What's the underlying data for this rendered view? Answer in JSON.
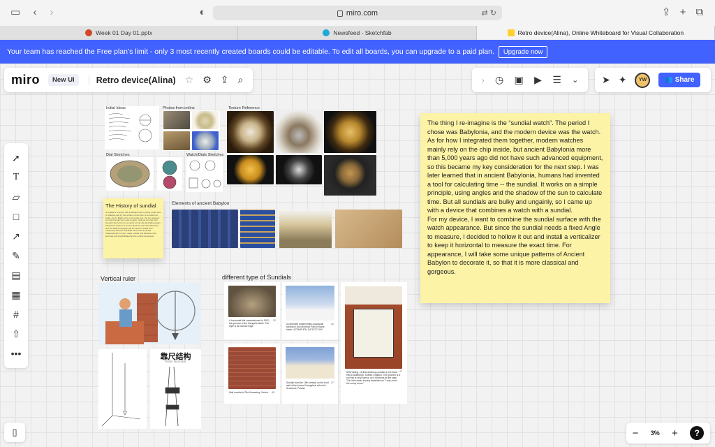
{
  "browser": {
    "url": "miro.com",
    "tabs": [
      {
        "label": "Week 01 Day 01.pptx",
        "icon": "powerpoint-icon",
        "active": false
      },
      {
        "label": "Newsfeed - Sketchfab",
        "icon": "sketchfab-icon",
        "active": false
      },
      {
        "label": "Retro device(Alina), Online Whiteboard for Visual Collaboration",
        "icon": "miro-icon",
        "active": true
      }
    ]
  },
  "banner": {
    "text": "Your team has reached the Free plan’s limit - only 3 most recently created boards could be editable. To edit all boards, you can upgrade to a paid plan.",
    "button": "Upgrade now"
  },
  "app": {
    "logo": "miro",
    "badge": "New UI",
    "board_title": "Retro device(Alina)",
    "share": "Share",
    "avatar": "YW",
    "zoom": "3%",
    "help": "?"
  },
  "board": {
    "initial_ideas": "Initial Ideas",
    "photos_online": "Photos from online",
    "texture_ref": "Texture Reference",
    "dial_sketches": "Dial Sketches",
    "watch_sketches": "Watch/Dials Sketches",
    "history_title": "The History of sundial",
    "history_body": "A sundial is a device that indicates time by using a light spot or shadow cast by the position of the Sun on a reference scale. As the Earth turns on its polar axis, the sun appears to cross the sky from east to west, rising at sun-rise from beneath the horizon to a zenith at mid-day and falling again behind the horizon at sunset. Both the azimuth (direction) and the altitude (height) can be used to create time measuring devices. Sundials have been invented independently in every major culture and became more accurate and sophisticated as the culture developed.",
    "babylon": "Elements of ancient Babylon",
    "vertical_ruler": "Vertical ruler",
    "ruler_cn": "靠尺结构",
    "ruler_en": "Ruler structure",
    "sundials_heading": "different type of Sundials",
    "sundial_caps": [
      {
        "text": "A horizontal dial commissioned in 1902, the gnomon is the triangular blade. The style is its inclined edge.",
        "n": "22"
      },
      {
        "text": "A combined analemmatic–equatorial sundial in Ann Morrison Park in Boise, Idaho, 43°36′49.8″N 116°12′27.0″W",
        "n": "42"
      },
      {
        "text": "Wall sundial in Žiče Monastery, Serbia.",
        "n": "45"
      },
      {
        "text": "Sundial from the 19th century on the front wall of the former Evangelical school in Szczekna, Poland.",
        "n": "37"
      },
      {
        "text": "SSW facing, vertical declining sundial on the Moot Hall in Aldeburgh, Suffolk, England. The gnomon is a rod that is very narrow, so it functions as the style. The Latin motto loosely translates as \"I only count the sunny hours.\"",
        "n": "47"
      }
    ],
    "main_note": "The thing I re-imagine is the “sundial watch”. The period I chose was Babylonia, and the modern device was the watch. As for how I integrated them together, modern watches mainly rely on the chip inside, but ancient Babylonia more than 5,000 years ago did not have such advanced equipment, so this became my key consideration for the next step. I was later learned that in ancient Babylonia, humans had invented a tool for calculating time -- the sundial. It works on a simple principle, using angles and the shadow of the sun to calculate time. But all sundials are bulky and ungainly, so I came up with a device that combines a watch with a sundial.\nFor my device, I want to combine the sundial surface with the watch appearance. But since the sundial needs a fixed Angle to measure, I decided to hollow it out and install a verticalizer to keep it horizontal to measure the exact time. For appearance, I will take some unique patterns of Ancient Babylon to decorate it, so that it is more classical and gorgeous."
  },
  "colors": {
    "accent": "#4262ff",
    "sticky": "#fdf3a6"
  }
}
